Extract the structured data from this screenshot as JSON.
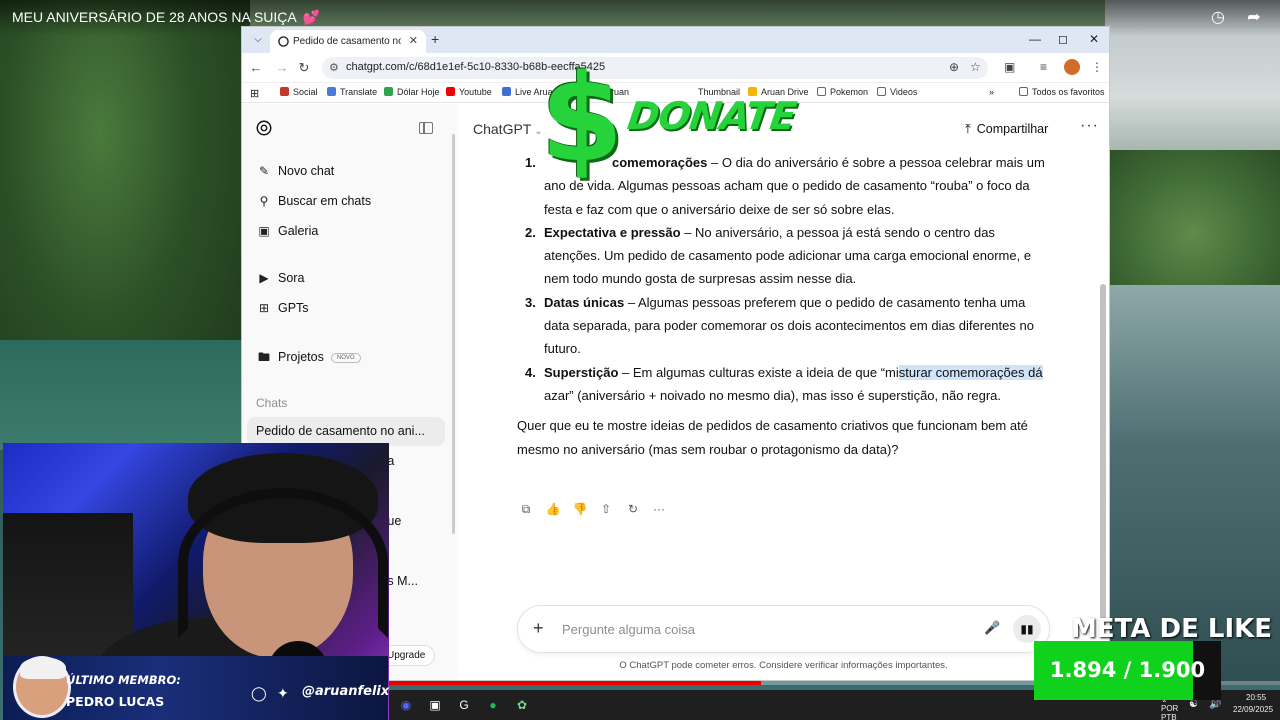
{
  "video": {
    "title": "MEU ANIVERSÁRIO DE 28 ANOS NA SUIÇA",
    "title_emoji": "💕"
  },
  "browser": {
    "tab_title": "Pedido de casamento no aniversário",
    "url": "chatgpt.com/c/68d1e1ef-5c10-8330-b68b-eecffa5425",
    "bookmarks": [
      "Social",
      "Translate",
      "Dólar Hoje",
      "Youtube",
      "Live Aruan",
      "Artes Aruan",
      "Thumbnail",
      "Aruan Drive",
      "Pokemon",
      "Videos"
    ],
    "all_bookmarks": "Todos os favoritos"
  },
  "sidebar": {
    "primary": [
      {
        "label": "Novo chat",
        "icon": "pencil-icon"
      },
      {
        "label": "Buscar em chats",
        "icon": "search-icon"
      },
      {
        "label": "Galeria",
        "icon": "gallery-icon"
      }
    ],
    "secondary": [
      {
        "label": "Sora",
        "icon": "play-icon"
      },
      {
        "label": "GPTs",
        "icon": "grid-icon"
      }
    ],
    "projects": {
      "label": "Projetos",
      "badge": "NOVO"
    },
    "section_label": "Chats",
    "chats": [
      "Pedido de casamento no ani...",
      "...a",
      "...ue",
      "...s M..."
    ],
    "upgrade": "Upgrade"
  },
  "header": {
    "model": "ChatGPT",
    "share": "Compartilhar"
  },
  "answer": {
    "items": [
      {
        "num": "1.",
        "bold": "comemorações",
        "text": " – O dia do aniversário é sobre a pessoa celebrar mais um ano de vida. Algumas pessoas acham que o pedido de casamento “rouba” o foco da festa e faz com que o aniversário deixe de ser só sobre elas."
      },
      {
        "num": "2.",
        "bold": "Expectativa e pressão",
        "text": " – No aniversário, a pessoa já está sendo o centro das atenções. Um pedido de casamento pode adicionar uma carga emocional enorme, e nem todo mundo gosta de surpresas assim nesse dia."
      },
      {
        "num": "3.",
        "bold": "Datas únicas",
        "text": " – Algumas pessoas preferem que o pedido de casamento tenha uma data separada, para poder comemorar os dois acontecimentos em dias diferentes no futuro."
      },
      {
        "num": "4.",
        "bold": "Superstição",
        "text_before": " – Em algumas culturas existe a ideia de que “mi",
        "highlight": "sturar comemorações dá",
        "text_after": " azar” (aniversário + noivado no mesmo dia), mas isso é superstição, não regra."
      }
    ],
    "closing": "Quer que eu te mostre ideias de pedidos de casamento criativos que funcionam bem até mesmo no aniversário (mas sem roubar o protagonismo da data)?"
  },
  "composer": {
    "placeholder": "Pergunte alguma coisa",
    "disclaimer": "O ChatGPT pode cometer erros. Considere verificar informações importantes."
  },
  "overlay": {
    "donate": "DONATE",
    "dollar": "$",
    "member_label": "ÚLTIMO MEMBRO:",
    "member_name": "PEDRO LUCAS",
    "handle": "@aruanfelix",
    "like_goal_title": "META DE LIKE",
    "like_goal": "1.894 / 1.900",
    "like_progress": 0.997
  },
  "taskbar": {
    "lang": "POR\nPTB",
    "time": "20:55",
    "date": "22/09/2025"
  },
  "colors": {
    "donate_green": "#27d33b",
    "like_green": "#10d11c",
    "progress_red": "#e00000",
    "highlight": "#cfe3f9"
  }
}
